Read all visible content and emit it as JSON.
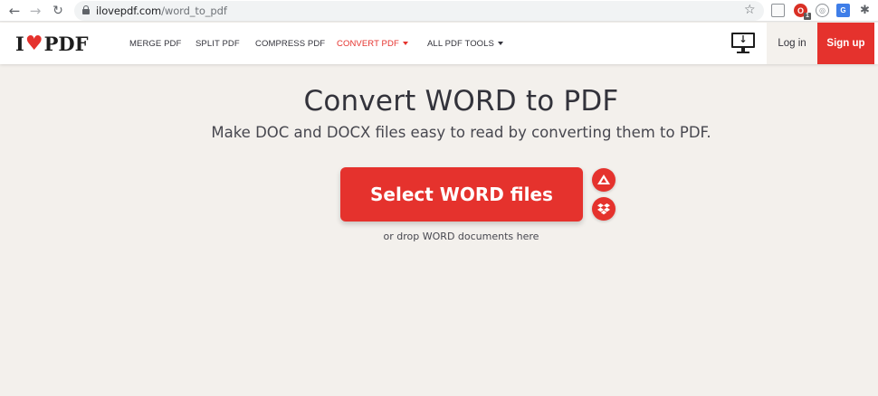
{
  "browser": {
    "url_host": "ilovepdf.com",
    "url_path": "/word_to_pdf",
    "ext_badge": "1"
  },
  "header": {
    "logo_left": "I",
    "logo_right": "PDF",
    "nav": {
      "merge": "MERGE PDF",
      "split": "SPLIT PDF",
      "compress": "COMPRESS PDF",
      "convert": "CONVERT PDF",
      "all_tools": "ALL PDF TOOLS"
    },
    "login": "Log in",
    "signup": "Sign up"
  },
  "main": {
    "title": "Convert WORD to PDF",
    "subtitle": "Make DOC and DOCX files easy to read by converting them to PDF.",
    "select_button": "Select WORD files",
    "drop_hint": "or drop WORD documents here"
  },
  "colors": {
    "brand_red": "#e5322d",
    "background": "#f3f0ec",
    "text_dark": "#33333b"
  },
  "icons": [
    "back-arrow-icon",
    "forward-arrow-icon",
    "reload-icon",
    "lock-icon",
    "star-icon",
    "heart-icon",
    "desktop-download-icon",
    "google-drive-icon",
    "dropbox-icon",
    "extensions-puzzle-icon"
  ]
}
